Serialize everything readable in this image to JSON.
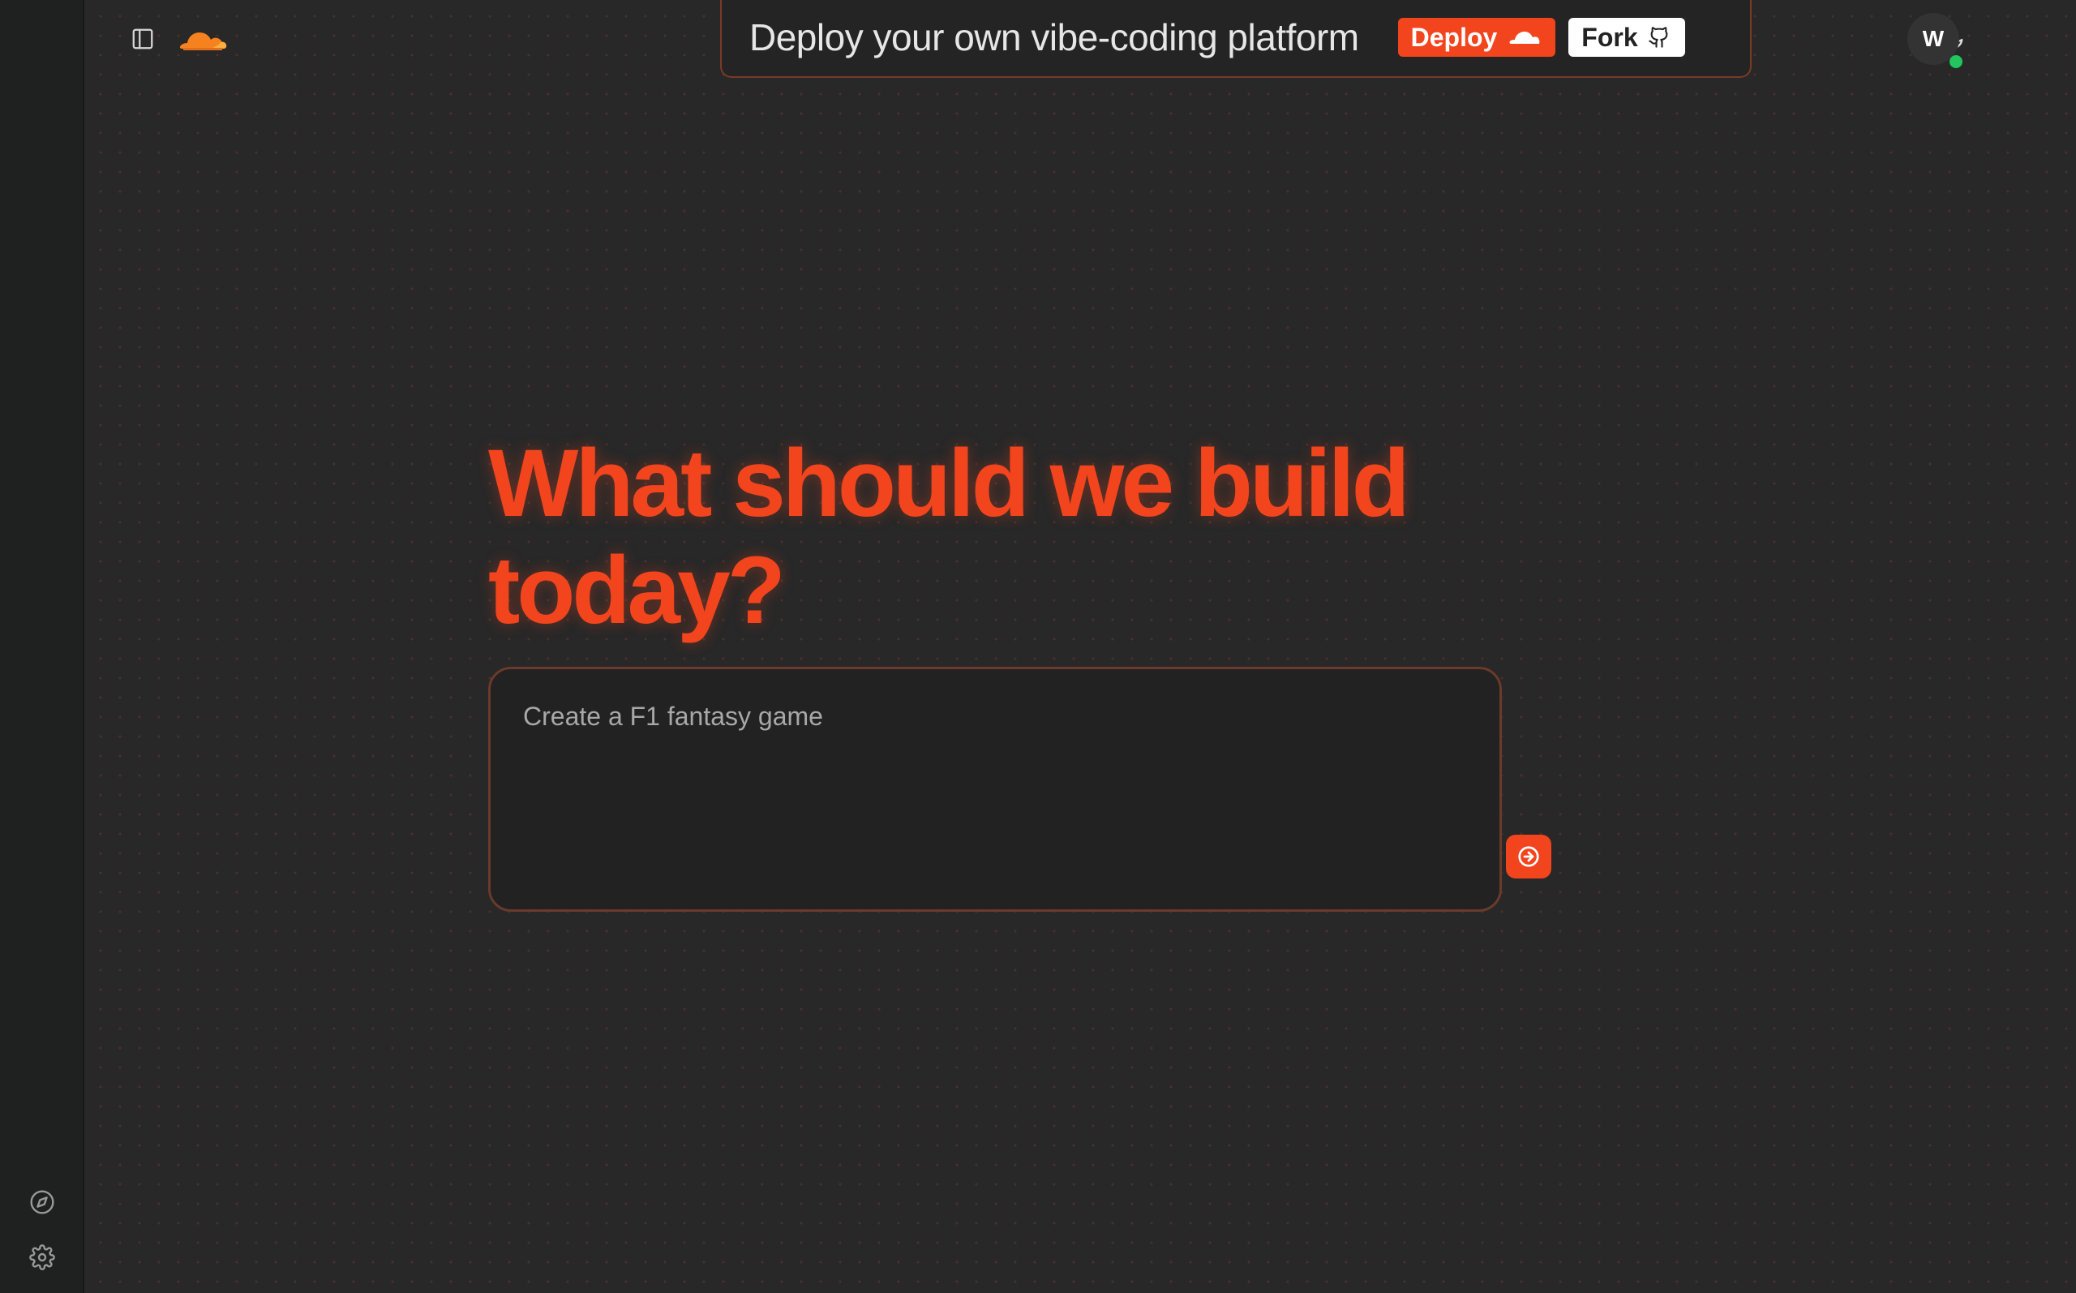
{
  "banner": {
    "text": "Deploy your own vibe-coding platform",
    "deploy_label": "Deploy",
    "fork_label": "Fork"
  },
  "user": {
    "initial": "W"
  },
  "hero": {
    "headline": "What should we build today?"
  },
  "prompt": {
    "placeholder": "Create a F1 fantasy game"
  },
  "icons": {
    "sidebar_toggle": "sidebar-panel-icon",
    "logo": "cloudflare-cloud-logo",
    "theme": "moon-icon",
    "discover": "compass-icon",
    "settings": "gear-icon",
    "send": "arrow-right-icon"
  },
  "colors": {
    "accent": "#f2441d",
    "background": "#282828",
    "rail": "#1f2020",
    "online": "#22c55e"
  }
}
